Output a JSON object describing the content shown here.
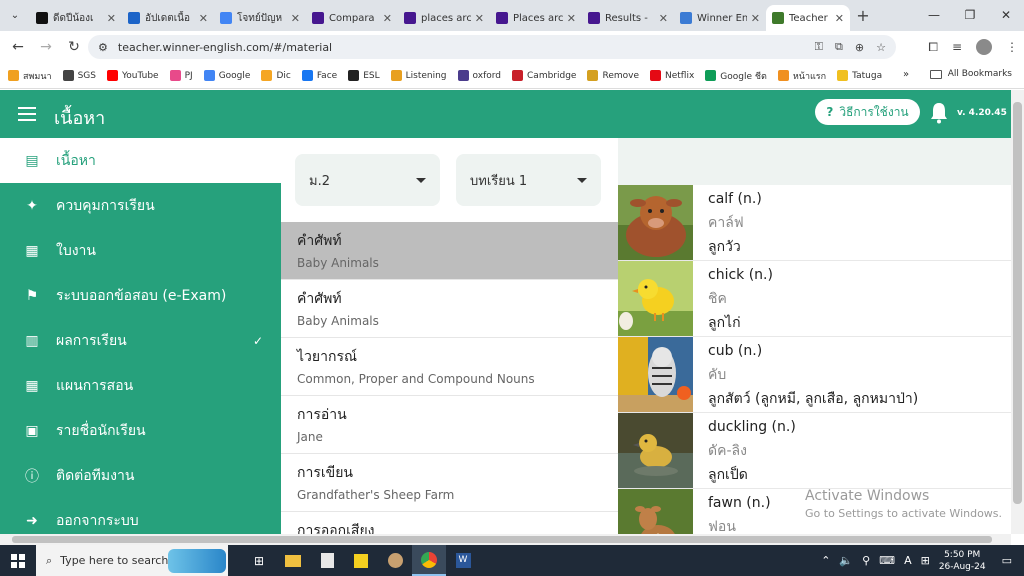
{
  "browser": {
    "tabs": [
      {
        "label": "ดีดปีน้องเ",
        "color": "#111111",
        "icon": "tiktok-icon"
      },
      {
        "label": "อัปเดตเนื้อ",
        "color": "#1c64c8",
        "icon": "meta-icon"
      },
      {
        "label": "โจทย์ปัญห",
        "color": "#4285f4",
        "icon": "google-icon"
      },
      {
        "label": "Compara",
        "color": "#46178f",
        "icon": "kahoot-icon"
      },
      {
        "label": "places arc",
        "color": "#46178f",
        "icon": "kahoot-icon"
      },
      {
        "label": "Places arc",
        "color": "#46178f",
        "icon": "kahoot-icon"
      },
      {
        "label": "Results - ",
        "color": "#46178f",
        "icon": "kahoot-icon"
      },
      {
        "label": "Winner En",
        "color": "#3b7bd4",
        "icon": "pen-icon"
      },
      {
        "label": "Teacher A",
        "color": "#3f7a2b",
        "icon": "winner-icon",
        "active": true
      }
    ],
    "url": "teacher.winner-english.com/#/material",
    "bookmarks": [
      {
        "label": "สพมนา",
        "color": "#f0a020"
      },
      {
        "label": "SGS",
        "color": "#444444"
      },
      {
        "label": "YouTube",
        "color": "#ff0000"
      },
      {
        "label": "PJ",
        "color": "#e84a8a"
      },
      {
        "label": "Google",
        "color": "#4285f4"
      },
      {
        "label": "Dic",
        "color": "#f5a623"
      },
      {
        "label": "Face",
        "color": "#1877f2"
      },
      {
        "label": "ESL",
        "color": "#222222"
      },
      {
        "label": "Listening",
        "color": "#e8a020"
      },
      {
        "label": "oxford",
        "color": "#4a3c8c"
      },
      {
        "label": "Cambridge",
        "color": "#c8202a"
      },
      {
        "label": "Remove",
        "color": "#d4a020"
      },
      {
        "label": "Netflix",
        "color": "#e50914"
      },
      {
        "label": "Google ชีต",
        "color": "#0f9d58"
      },
      {
        "label": "หน้าแรก",
        "color": "#f09020"
      },
      {
        "label": "Tatuga",
        "color": "#f0c020"
      }
    ],
    "bookmarks_more": "»",
    "all_bookmarks": "All Bookmarks"
  },
  "app": {
    "title": "เนื้อหา",
    "help_label": "วิธีการใช้งาน",
    "version": "v. 4.20.45",
    "accent": "#26a17c"
  },
  "sidebar": {
    "items": [
      {
        "label": "เนื้อหา",
        "icon": "book-icon",
        "glyph": "▤",
        "active": true
      },
      {
        "label": "ควบคุมการเรียน",
        "icon": "magic-wand-icon",
        "glyph": "✦"
      },
      {
        "label": "ใบงาน",
        "icon": "file-icon",
        "glyph": "▦"
      },
      {
        "label": "ระบบออกข้อสอบ (e-Exam)",
        "icon": "flag-icon",
        "glyph": "⚑"
      },
      {
        "label": "ผลการเรียน",
        "icon": "bar-chart-icon",
        "glyph": "▥",
        "chevron": "✓"
      },
      {
        "label": "แผนการสอน",
        "icon": "calendar-icon",
        "glyph": "▦"
      },
      {
        "label": "รายชื่อนักเรียน",
        "icon": "id-card-icon",
        "glyph": "▣"
      },
      {
        "label": "ติดต่อทีมงาน",
        "icon": "info-icon",
        "glyph": "ⓘ"
      },
      {
        "label": "ออกจากระบบ",
        "icon": "logout-icon",
        "glyph": "➜"
      }
    ]
  },
  "filters": {
    "grade": "ม.2",
    "lesson": "บทเรียน 1"
  },
  "lessons": [
    {
      "type": "คำศัพท์",
      "title": "Baby Animals",
      "selected": true
    },
    {
      "type": "คำศัพท์",
      "title": "Baby Animals"
    },
    {
      "type": "ไวยากรณ์",
      "title": "Common, Proper and Compound Nouns"
    },
    {
      "type": "การอ่าน",
      "title": "Jane"
    },
    {
      "type": "การเขียน",
      "title": "Grandfather's Sheep Farm"
    },
    {
      "type": "การออกเสียง",
      "title": ""
    }
  ],
  "vocab": [
    {
      "word": "calf (n.)",
      "reading": "คาล์ฟ",
      "meaning": "ลูกวัว",
      "image": "calf-image"
    },
    {
      "word": "chick (n.)",
      "reading": "ชิค",
      "meaning": "ลูกไก่",
      "image": "chick-image"
    },
    {
      "word": "cub (n.)",
      "reading": "คับ",
      "meaning": "ลูกสัตว์ (ลูกหมี, ลูกเสือ, ลูกหมาป่า)",
      "image": "cub-image"
    },
    {
      "word": "duckling (n.)",
      "reading": "ดัค-ลิง",
      "meaning": "ลูกเป็ด",
      "image": "duckling-image"
    },
    {
      "word": "fawn (n.)",
      "reading": "ฟอน",
      "meaning": "",
      "image": "fawn-image"
    }
  ],
  "watermark": {
    "line1": "Activate Windows",
    "line2": "Go to Settings to activate Windows."
  },
  "taskbar": {
    "search_placeholder": "Type here to search",
    "time": "5:50 PM",
    "date": "26-Aug-24",
    "input_lang": "A"
  }
}
